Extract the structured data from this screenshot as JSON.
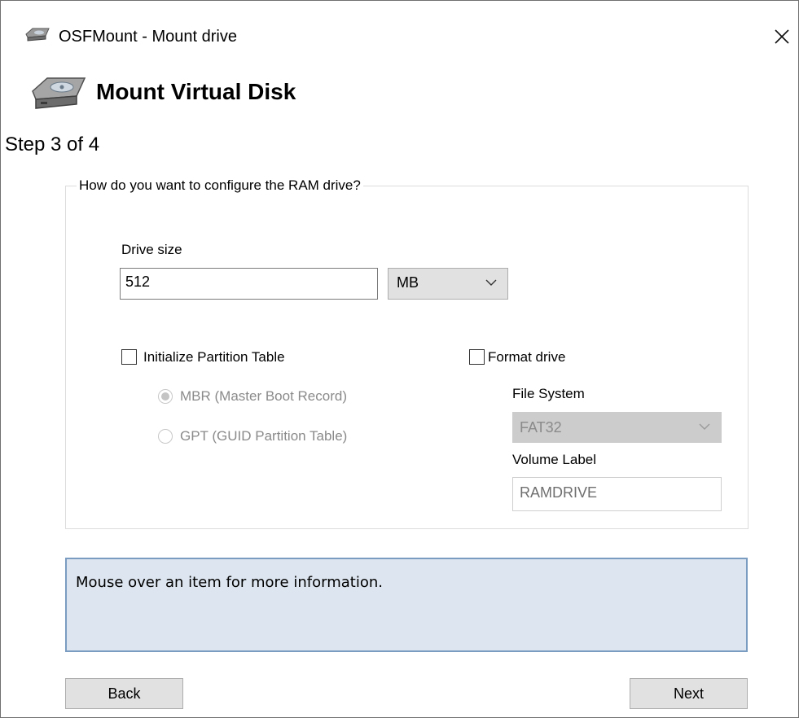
{
  "window": {
    "title": "OSFMount - Mount drive",
    "icon": "drive-icon",
    "close_icon": "close-icon"
  },
  "header": {
    "title": "Mount Virtual Disk",
    "icon": "drive-icon"
  },
  "step": "Step 3 of 4",
  "group": {
    "legend": "How do you want to configure the RAM drive?",
    "drive_size": {
      "label": "Drive size",
      "value": "512",
      "unit": "MB"
    },
    "partition": {
      "label": "Initialize Partition Table",
      "checked": false,
      "options": [
        {
          "label": "MBR (Master Boot Record)",
          "selected": true
        },
        {
          "label": "GPT (GUID Partition Table)",
          "selected": false
        }
      ]
    },
    "format": {
      "label": "Format drive",
      "checked": false,
      "file_system_label": "File System",
      "file_system_value": "FAT32",
      "volume_label_label": "Volume Label",
      "volume_label_value": "RAMDRIVE"
    }
  },
  "info": {
    "text": "Mouse over an item for more information."
  },
  "buttons": {
    "back": "Back",
    "next": "Next"
  },
  "colors": {
    "info_bg": "#dde6f0",
    "info_border": "#7a9cc0",
    "button_bg": "#e1e1e1",
    "disabled_text": "#8a8a8a"
  }
}
